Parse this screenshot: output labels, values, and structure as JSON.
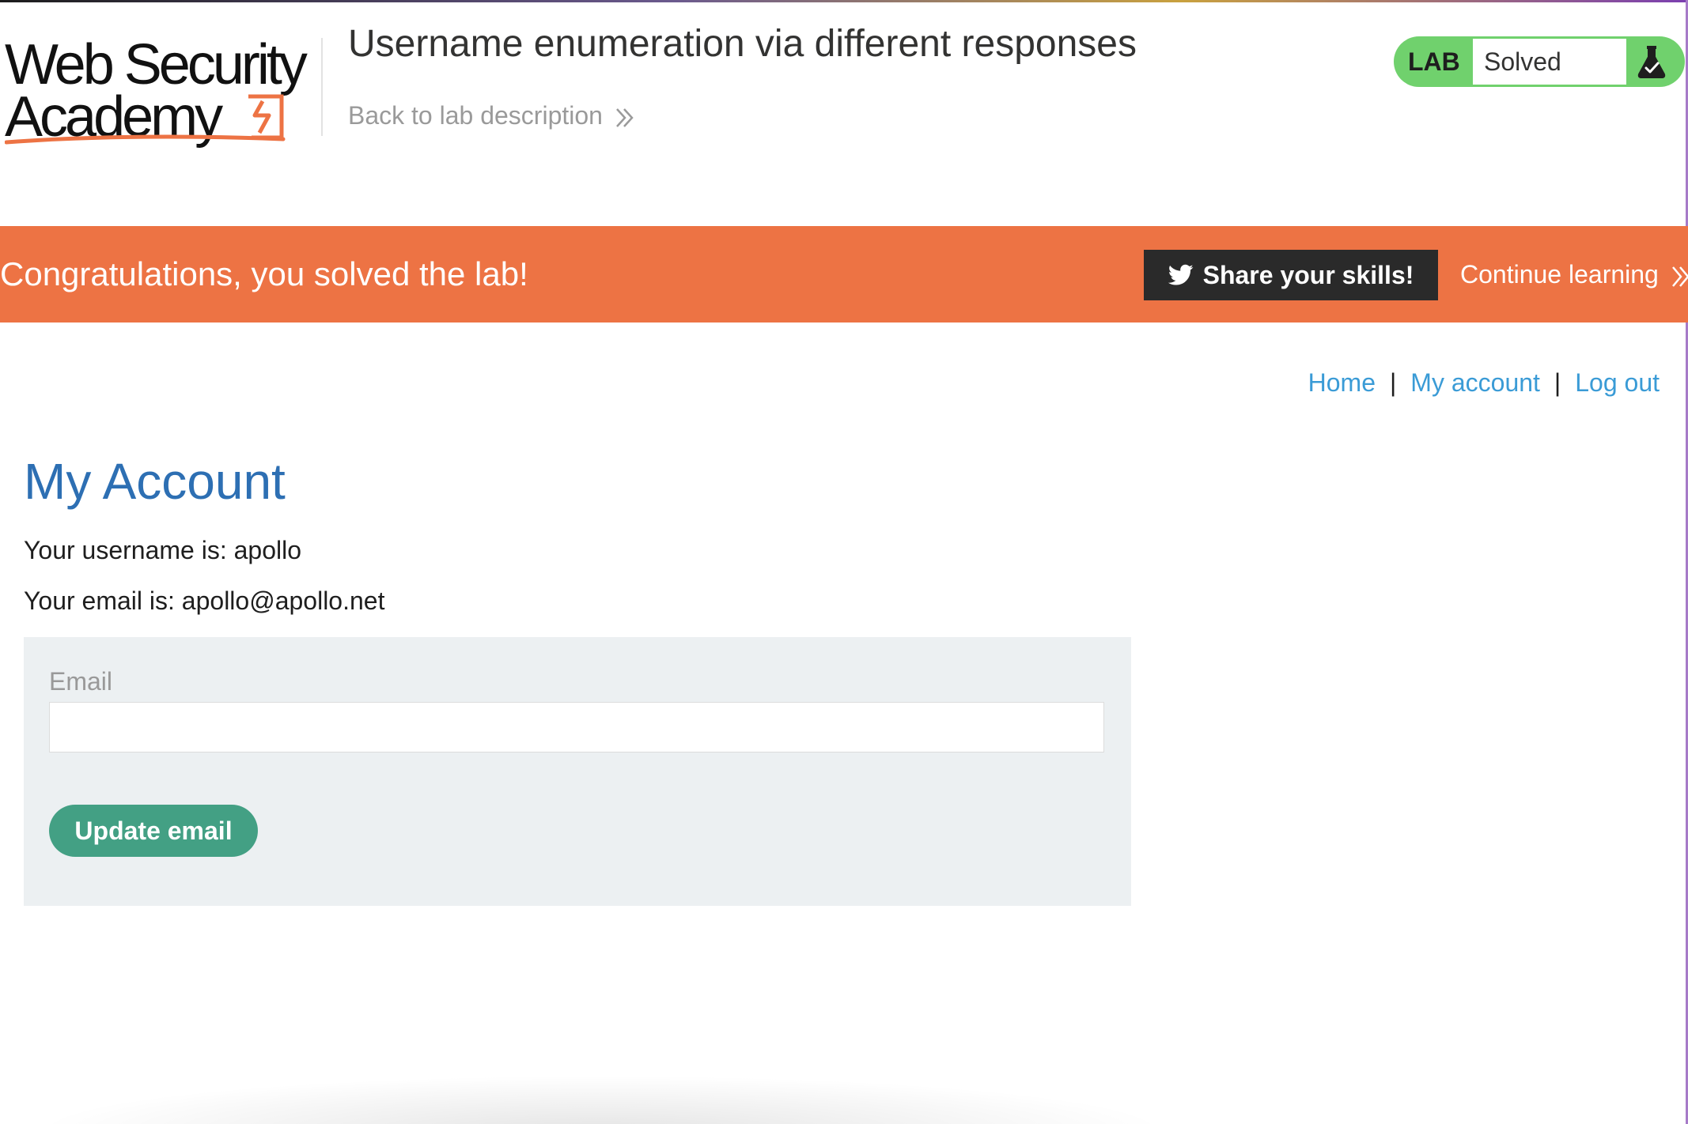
{
  "header": {
    "logo_line1": "Web Security",
    "logo_line2": "Academy",
    "lab_title": "Username enumeration via different responses",
    "back_link": "Back to lab description"
  },
  "lab_status": {
    "label": "LAB",
    "state": "Solved",
    "accent_color": "#70d16d"
  },
  "banner": {
    "message": "Congratulations, you solved the lab!",
    "share_label": "Share your skills!",
    "continue_label": "Continue learning",
    "background_color": "#ed7344"
  },
  "nav": {
    "items": [
      {
        "label": "Home"
      },
      {
        "label": "My account"
      },
      {
        "label": "Log out"
      }
    ],
    "separator": "|"
  },
  "main": {
    "title": "My Account",
    "username_line": "Your username is: apollo",
    "email_line": "Your email is: apollo@apollo.net",
    "form": {
      "email_label": "Email",
      "email_value": "",
      "update_label": "Update email",
      "button_color": "#43a084"
    }
  },
  "icons": [
    "flask-check-icon",
    "twitter-icon",
    "chevron-double-right-icon",
    "logo-lightning-icon"
  ]
}
